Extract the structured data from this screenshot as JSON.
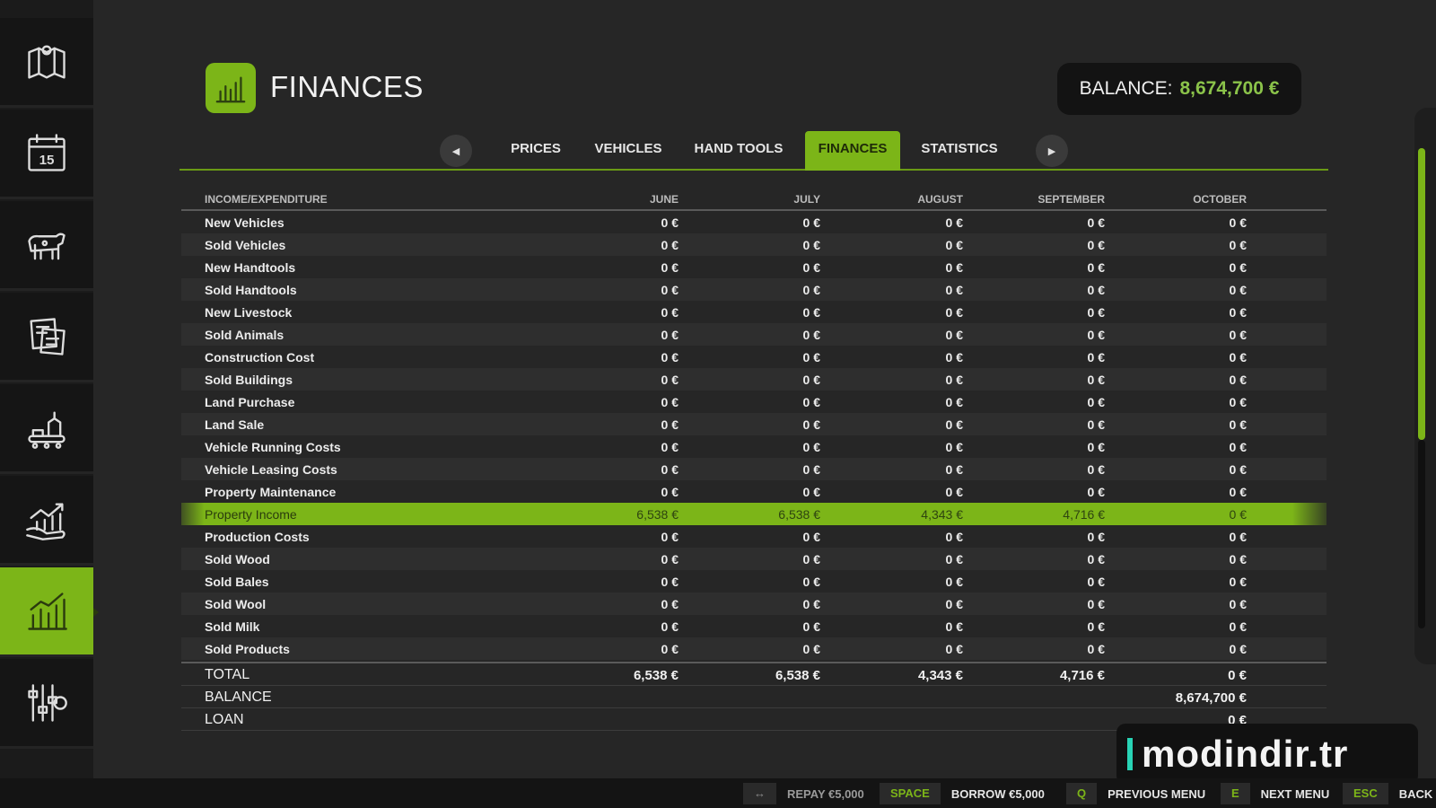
{
  "sidebar": {
    "items": [
      {
        "icon": "map-icon"
      },
      {
        "icon": "calendar-icon",
        "badge": "15"
      },
      {
        "icon": "animals-icon"
      },
      {
        "icon": "contracts-icon"
      },
      {
        "icon": "production-icon"
      },
      {
        "icon": "finance-growth-icon"
      },
      {
        "icon": "finances-chart-icon",
        "active": true
      },
      {
        "icon": "settings-icon"
      }
    ]
  },
  "header": {
    "title": "FINANCES",
    "balance_label": "BALANCE:",
    "balance_value": "8,674,700 €"
  },
  "tabs": [
    {
      "label": "PRICES"
    },
    {
      "label": "VEHICLES"
    },
    {
      "label": "HAND TOOLS"
    },
    {
      "label": "FINANCES",
      "active": true
    },
    {
      "label": "STATISTICS"
    }
  ],
  "table": {
    "columns": [
      "INCOME/EXPENDITURE",
      "JUNE",
      "JULY",
      "AUGUST",
      "SEPTEMBER",
      "OCTOBER"
    ],
    "rows": [
      {
        "label": "New Vehicles",
        "values": [
          "0 €",
          "0 €",
          "0 €",
          "0 €",
          "0 €"
        ]
      },
      {
        "label": "Sold Vehicles",
        "values": [
          "0 €",
          "0 €",
          "0 €",
          "0 €",
          "0 €"
        ]
      },
      {
        "label": "New Handtools",
        "values": [
          "0 €",
          "0 €",
          "0 €",
          "0 €",
          "0 €"
        ]
      },
      {
        "label": "Sold Handtools",
        "values": [
          "0 €",
          "0 €",
          "0 €",
          "0 €",
          "0 €"
        ]
      },
      {
        "label": "New Livestock",
        "values": [
          "0 €",
          "0 €",
          "0 €",
          "0 €",
          "0 €"
        ]
      },
      {
        "label": "Sold Animals",
        "values": [
          "0 €",
          "0 €",
          "0 €",
          "0 €",
          "0 €"
        ]
      },
      {
        "label": "Construction Cost",
        "values": [
          "0 €",
          "0 €",
          "0 €",
          "0 €",
          "0 €"
        ]
      },
      {
        "label": "Sold Buildings",
        "values": [
          "0 €",
          "0 €",
          "0 €",
          "0 €",
          "0 €"
        ]
      },
      {
        "label": "Land Purchase",
        "values": [
          "0 €",
          "0 €",
          "0 €",
          "0 €",
          "0 €"
        ]
      },
      {
        "label": "Land Sale",
        "values": [
          "0 €",
          "0 €",
          "0 €",
          "0 €",
          "0 €"
        ]
      },
      {
        "label": "Vehicle Running Costs",
        "values": [
          "0 €",
          "0 €",
          "0 €",
          "0 €",
          "0 €"
        ]
      },
      {
        "label": "Vehicle Leasing Costs",
        "values": [
          "0 €",
          "0 €",
          "0 €",
          "0 €",
          "0 €"
        ]
      },
      {
        "label": "Property Maintenance",
        "values": [
          "0 €",
          "0 €",
          "0 €",
          "0 €",
          "0 €"
        ]
      },
      {
        "label": "Property Income",
        "values": [
          "6,538 €",
          "6,538 €",
          "4,343 €",
          "4,716 €",
          "0 €"
        ],
        "highlighted": true
      },
      {
        "label": "Production Costs",
        "values": [
          "0 €",
          "0 €",
          "0 €",
          "0 €",
          "0 €"
        ]
      },
      {
        "label": "Sold Wood",
        "values": [
          "0 €",
          "0 €",
          "0 €",
          "0 €",
          "0 €"
        ]
      },
      {
        "label": "Sold Bales",
        "values": [
          "0 €",
          "0 €",
          "0 €",
          "0 €",
          "0 €"
        ]
      },
      {
        "label": "Sold Wool",
        "values": [
          "0 €",
          "0 €",
          "0 €",
          "0 €",
          "0 €"
        ]
      },
      {
        "label": "Sold Milk",
        "values": [
          "0 €",
          "0 €",
          "0 €",
          "0 €",
          "0 €"
        ]
      },
      {
        "label": "Sold Products",
        "values": [
          "0 €",
          "0 €",
          "0 €",
          "0 €",
          "0 €"
        ]
      }
    ],
    "totals": [
      {
        "label": "TOTAL",
        "values": [
          "6,538 €",
          "6,538 €",
          "4,343 €",
          "4,716 €",
          "0 €"
        ]
      },
      {
        "label": "BALANCE",
        "values": [
          "",
          "",
          "",
          "",
          "8,674,700 €"
        ]
      },
      {
        "label": "LOAN",
        "values": [
          "",
          "",
          "",
          "",
          "0 €"
        ]
      }
    ]
  },
  "watermark": "modindir.tr",
  "hints": [
    {
      "key": "↔",
      "label": "REPAY €5,000",
      "dim": true
    },
    {
      "key": "SPACE",
      "label": "BORROW €5,000"
    },
    {
      "key": "Q",
      "label": "PREVIOUS MENU"
    },
    {
      "key": "E",
      "label": "NEXT MENU"
    },
    {
      "key": "ESC",
      "label": "BACK"
    }
  ],
  "colors": {
    "accent": "#7cb518",
    "balance_green": "#8bc34a",
    "background": "#262626"
  }
}
